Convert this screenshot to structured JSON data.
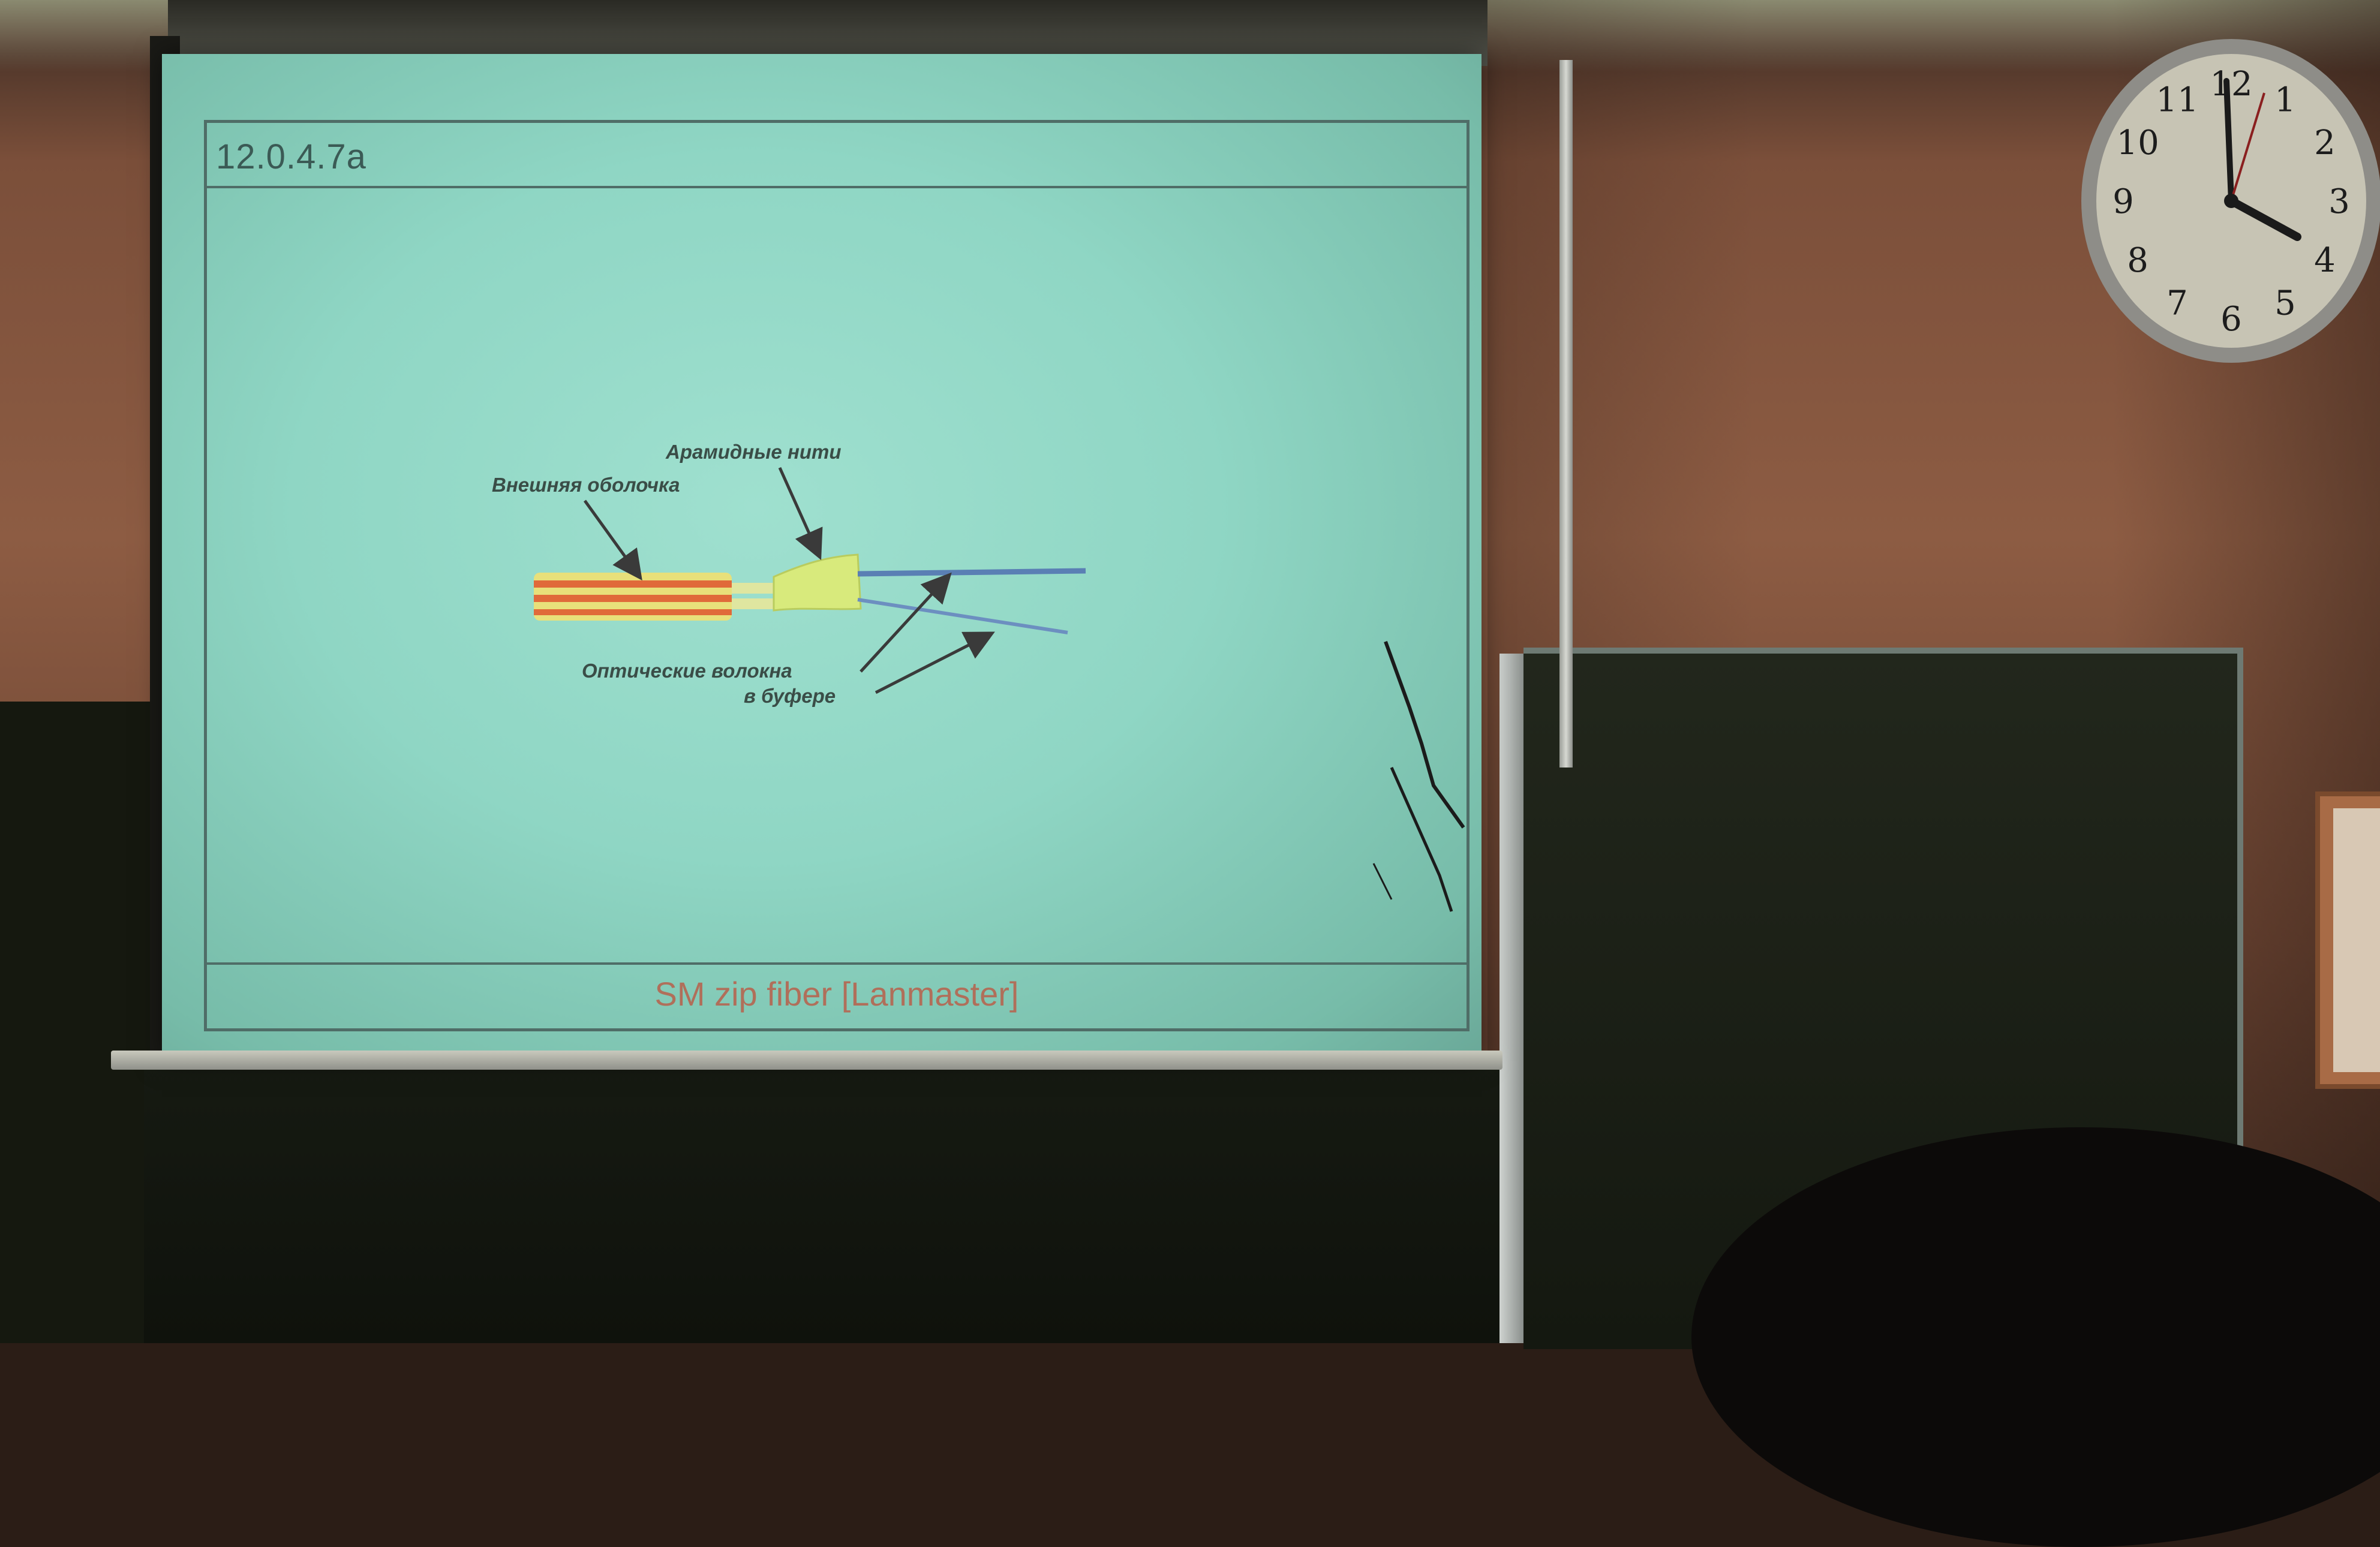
{
  "slide": {
    "number": "12.0.4.7a",
    "caption": "SM zip fiber [Lanmaster]",
    "labels": {
      "aramid": "Арамидные нити",
      "jacket": "Внешняя оболочка",
      "fibers_line1": "Оптические волокна",
      "fibers_line2": "в буфере"
    }
  },
  "clock": {
    "numerals": [
      "12",
      "1",
      "2",
      "3",
      "4",
      "5",
      "6",
      "7",
      "8",
      "9",
      "10",
      "11"
    ]
  },
  "colors": {
    "screen": "#8fd6c4",
    "wall": "#8d5c43",
    "jacket_yellow": "#e8e07a",
    "jacket_orange": "#e06a3a",
    "aramid_yellow": "#d8ea7c",
    "fiber_blue": "#5a7fb4"
  }
}
